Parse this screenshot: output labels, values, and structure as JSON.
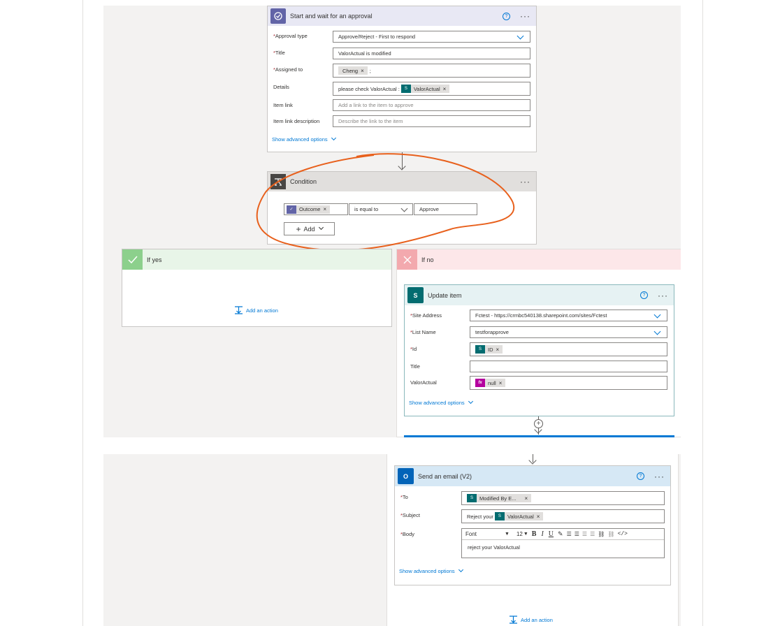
{
  "approval": {
    "title": "Start and wait for an approval",
    "fields": [
      {
        "label": "Approval type",
        "required": true,
        "value": "Approve/Reject - First to respond"
      },
      {
        "label": "Title",
        "required": true,
        "value": "ValorActual is modified"
      },
      {
        "label": "Assigned to",
        "required": true,
        "token": "Cheng",
        "suffix": ";"
      },
      {
        "label": "Details",
        "required": false,
        "prefix": "please check ValorActual :",
        "token": "ValorActual"
      },
      {
        "label": "Item link",
        "required": false,
        "placeholder": "Add a link to the item to approve"
      },
      {
        "label": "Item link description",
        "required": false,
        "placeholder": "Describe the link to the item"
      }
    ],
    "advanced": "Show advanced options"
  },
  "condition": {
    "title": "Condition",
    "operand_token": "Outcome",
    "operator": "is equal to",
    "value": "Approve",
    "add_label": "Add"
  },
  "if_yes": {
    "title": "If yes",
    "add_action": "Add an action"
  },
  "if_no": {
    "title": "If no"
  },
  "update_item": {
    "title": "Update item",
    "fields": [
      {
        "label": "Site Address",
        "required": true,
        "value": "Fctest - https://crmbc540138.sharepoint.com/sites/Fctest"
      },
      {
        "label": "List Name",
        "required": true,
        "value": "testforapprove"
      },
      {
        "label": "Id",
        "required": true,
        "token": "ID"
      },
      {
        "label": "Title",
        "required": false
      },
      {
        "label": "ValorActual",
        "required": false,
        "token": "null",
        "fx_icon": "fx"
      }
    ],
    "advanced": "Show advanced options"
  },
  "send_email": {
    "title": "Send an email (V2)",
    "to_label": "To",
    "to_token": "Modified By E...",
    "subject_label": "Subject",
    "subject_prefix": "Reject your",
    "subject_token": "ValorActual",
    "body_label": "Body",
    "toolbar_font": "Font",
    "toolbar_size": "12",
    "toolbar_bold": "B",
    "toolbar_italic": "I",
    "toolbar_underline": "U",
    "body_text": "reject your ValorActual",
    "advanced": "Show advanced options",
    "add_action": "Add an action"
  },
  "colors": {
    "approval_accent": "#6264a7",
    "condition_header": "#e1dfdd",
    "yes_header": "#e8f5e8",
    "no_header": "#fde7e9",
    "sharepoint_header": "#e6f2f3",
    "email_header": "#d6e8f5",
    "annotation": "#e8601c",
    "link": "#0078d4"
  }
}
